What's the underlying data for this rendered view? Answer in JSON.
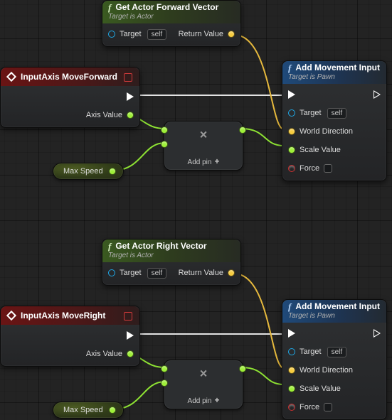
{
  "forward": {
    "getvec": {
      "title": "Get Actor Forward Vector",
      "subtitle": "Target is Actor",
      "target_label": "Target",
      "target_self": "self",
      "return_label": "Return Value"
    },
    "event": {
      "title": "InputAxis MoveForward",
      "axis_label": "Axis Value"
    },
    "mult": {
      "add_label": "Add pin"
    },
    "var": {
      "name": "Max Speed"
    },
    "move": {
      "title": "Add Movement Input",
      "subtitle": "Target is Pawn",
      "target_label": "Target",
      "target_self": "self",
      "dir_label": "World Direction",
      "scale_label": "Scale Value",
      "force_label": "Force"
    }
  },
  "right": {
    "getvec": {
      "title": "Get Actor Right Vector",
      "subtitle": "Target is Actor",
      "target_label": "Target",
      "target_self": "self",
      "return_label": "Return Value"
    },
    "event": {
      "title": "InputAxis MoveRight",
      "axis_label": "Axis Value"
    },
    "mult": {
      "add_label": "Add pin"
    },
    "var": {
      "name": "Max Speed"
    },
    "move": {
      "title": "Add Movement Input",
      "subtitle": "Target is Pawn",
      "target_label": "Target",
      "target_self": "self",
      "dir_label": "World Direction",
      "scale_label": "Scale Value",
      "force_label": "Force"
    }
  }
}
